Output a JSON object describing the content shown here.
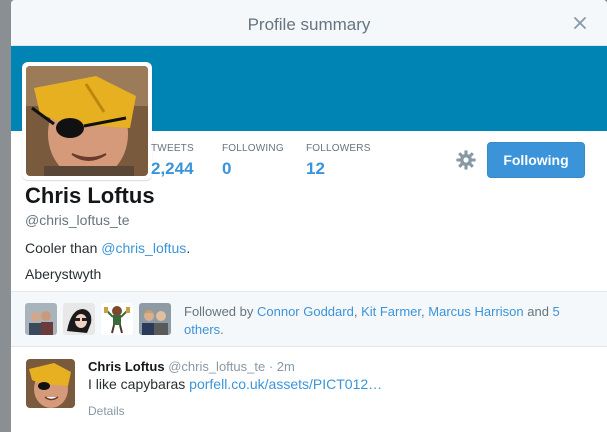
{
  "modal": {
    "title": "Profile summary",
    "close_icon": "close-icon"
  },
  "colors": {
    "banner": "#0084b4",
    "accent": "#3b94d9",
    "muted": "#66757f"
  },
  "profile": {
    "name": "Chris Loftus",
    "screen_name": "@chris_loftus_te",
    "bio_prefix": "Cooler than ",
    "bio_mention": "@chris_loftus",
    "bio_suffix": ".",
    "location": "Aberystwyth"
  },
  "stats": [
    {
      "label": "TWEETS",
      "value": "2,244"
    },
    {
      "label": "FOLLOWING",
      "value": "0"
    },
    {
      "label": "FOLLOWERS",
      "value": "12"
    }
  ],
  "actions": {
    "settings_icon": "gear-icon",
    "follow_label": "Following"
  },
  "followed_by": {
    "prefix": "Followed by ",
    "names": [
      "Connor Goddard",
      "Kit Farmer",
      "Marcus Harrison"
    ],
    "sep1": ", ",
    "sep2": ", ",
    "and": " and ",
    "others_link": "5 others",
    "suffix": "."
  },
  "tweet": {
    "name": "Chris Loftus",
    "screen_name": "@chris_loftus_te",
    "separator": " · ",
    "time": "2m",
    "text": "I like capybaras ",
    "link": "porfell.co.uk/assets/PICT012…",
    "details": "Details"
  }
}
